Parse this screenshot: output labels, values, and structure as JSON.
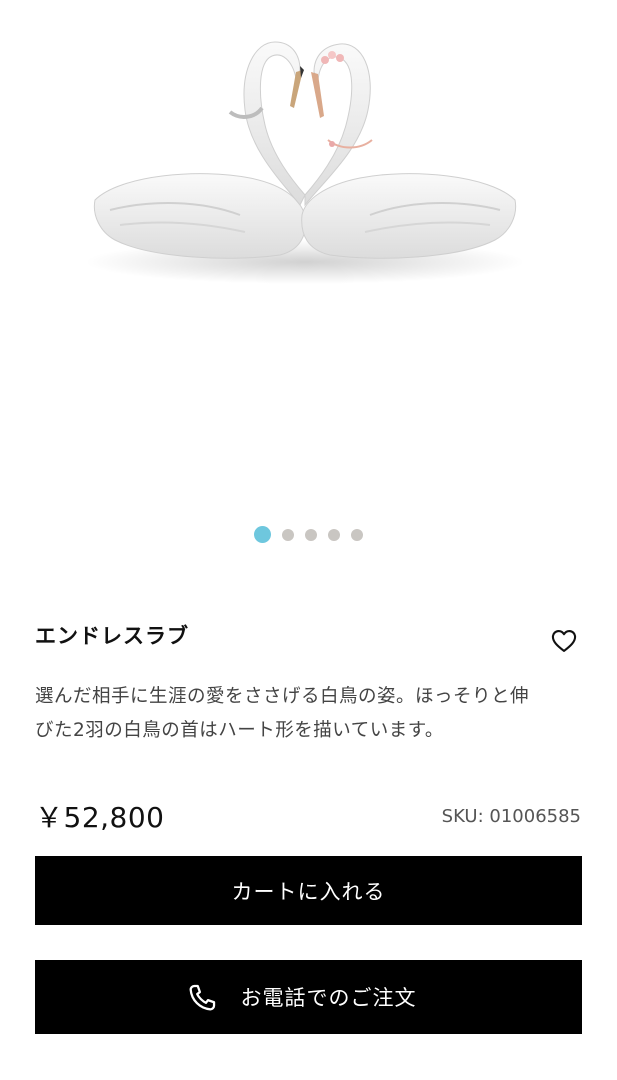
{
  "gallery": {
    "image_alt": "white porcelain swan figurine pair",
    "slides_total": 5,
    "active_slide": 1,
    "dot_active_color": "#6ec7de",
    "dot_color": "#c9c6c2"
  },
  "product": {
    "title": "エンドレスラブ",
    "description_line1": "選んだ相手に生涯の愛をささげる白鳥の姿。ほっそりと伸",
    "description_line2": "びた2羽の白鳥の首はハート形を描いています。",
    "price": "￥52,800",
    "sku": "SKU: 01006585"
  },
  "actions": {
    "add_to_cart_label": "カートに入れる",
    "phone_order_label": "お電話でのご注文",
    "phone_icon": "phone-icon",
    "favorite_icon": "heart-icon"
  },
  "colors": {
    "button_bg": "#000000",
    "button_text": "#ffffff"
  }
}
